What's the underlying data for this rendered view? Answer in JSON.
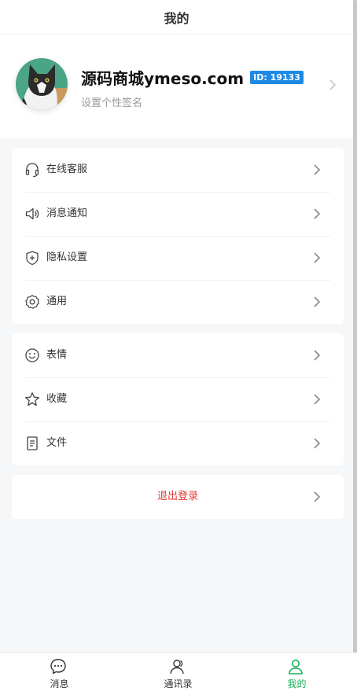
{
  "header": {
    "title": "我的"
  },
  "profile": {
    "name": "源码商城ymeso.com",
    "id_badge": "ID: 19133",
    "signature": "设置个性签名"
  },
  "menu_group_1": [
    {
      "label": "在线客服",
      "icon": "headset-icon"
    },
    {
      "label": "消息通知",
      "icon": "speaker-icon"
    },
    {
      "label": "隐私设置",
      "icon": "shield-plus-icon"
    },
    {
      "label": "通用",
      "icon": "settings-gear-icon"
    }
  ],
  "menu_group_2": [
    {
      "label": "表情",
      "icon": "smiley-icon"
    },
    {
      "label": "收藏",
      "icon": "star-icon"
    },
    {
      "label": "文件",
      "icon": "document-icon"
    }
  ],
  "logout": {
    "label": "退出登录"
  },
  "tabbar": {
    "items": [
      {
        "label": "消息",
        "icon": "chat-bubble-icon"
      },
      {
        "label": "通讯录",
        "icon": "contacts-icon"
      },
      {
        "label": "我的",
        "icon": "user-icon",
        "active": true
      }
    ]
  },
  "colors": {
    "accent_green": "#16b25a",
    "id_badge_blue": "#1e88e5",
    "logout_red": "#e53935"
  }
}
